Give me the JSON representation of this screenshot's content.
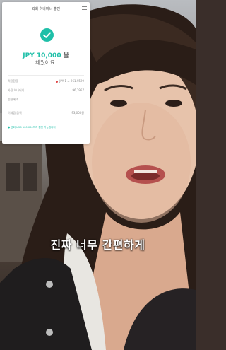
{
  "app_card": {
    "header_title": "외화 하나머니 충전",
    "menu_icon": "hamburger-menu-icon",
    "success_icon": "check-circle-icon",
    "amount": "JPY 10,000",
    "amount_suffix": "을",
    "result_text": "채웠어요.",
    "rows": [
      {
        "label": "적용환율",
        "value": "JPY 1 = 961.9599"
      },
      {
        "label": "사용 하나머니",
        "value": "96,1957"
      },
      {
        "label": "전환혜택",
        "value": ""
      },
      {
        "label": "이체금 금액",
        "value": "93,000원"
      }
    ],
    "note": "● 엔화 USD 100,000까지 환전 가능합니다"
  },
  "subtitle": "진짜 너무 간편하게",
  "colors": {
    "accent": "#1ebfa8",
    "rate_dot": "#e14a4a"
  }
}
